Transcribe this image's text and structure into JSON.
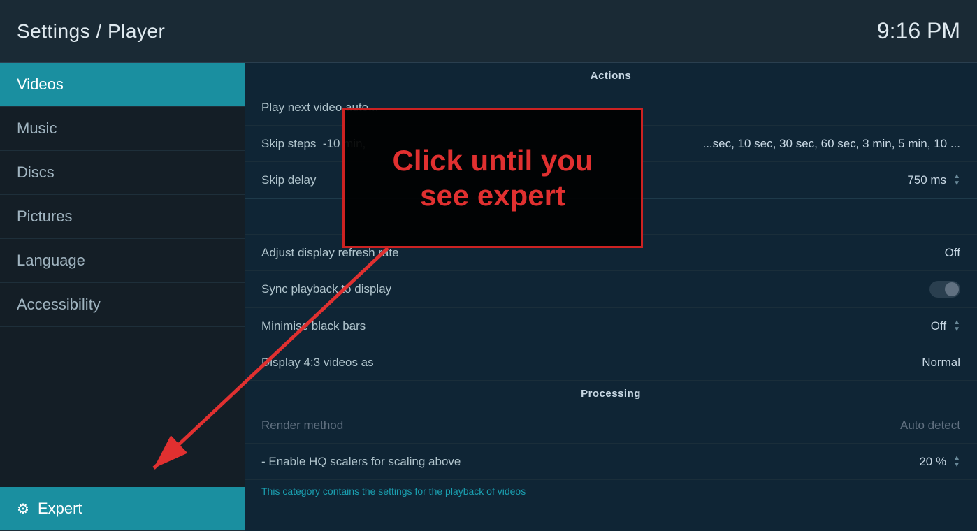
{
  "header": {
    "title": "Settings / Player",
    "time": "9:16 PM"
  },
  "sidebar": {
    "items": [
      {
        "id": "videos",
        "label": "Videos",
        "active": true
      },
      {
        "id": "music",
        "label": "Music",
        "active": false
      },
      {
        "id": "discs",
        "label": "Discs",
        "active": false
      },
      {
        "id": "pictures",
        "label": "Pictures",
        "active": false
      },
      {
        "id": "language",
        "label": "Language",
        "active": false
      },
      {
        "id": "accessibility",
        "label": "Accessibility",
        "active": false
      }
    ],
    "expert_label": "Expert"
  },
  "content": {
    "sections": [
      {
        "id": "actions",
        "header": "Actions",
        "rows": [
          {
            "id": "play-next-video",
            "label": "Play next video auto...",
            "value": "",
            "type": "text",
            "dimmed": false
          },
          {
            "id": "skip-steps",
            "label": "Skip steps   -10 min, ...",
            "value": "...sec, 10 sec, 30 sec, 60 sec, 3 min, 5 min, 10 ...",
            "type": "text",
            "dimmed": false
          },
          {
            "id": "skip-delay",
            "label": "Skip delay",
            "value": "750 ms",
            "type": "chevron",
            "dimmed": false
          }
        ]
      },
      {
        "id": "playback",
        "header": "",
        "rows": [
          {
            "id": "adjust-display-refresh",
            "label": "Adjust display refresh rate",
            "value": "Off",
            "type": "text",
            "dimmed": false
          },
          {
            "id": "sync-playback",
            "label": "Sync playback to display",
            "value": "",
            "type": "toggle",
            "dimmed": false
          },
          {
            "id": "minimise-black-bars",
            "label": "Minimise black bars",
            "value": "Off",
            "type": "chevron",
            "dimmed": false
          },
          {
            "id": "display-43",
            "label": "Display 4:3 videos as",
            "value": "Normal",
            "type": "text",
            "dimmed": false
          }
        ]
      },
      {
        "id": "processing",
        "header": "Processing",
        "rows": [
          {
            "id": "render-method",
            "label": "Render method",
            "value": "Auto detect",
            "type": "text",
            "dimmed": true
          },
          {
            "id": "enable-hq-scalers",
            "label": "- Enable HQ scalers for scaling above",
            "value": "20 %",
            "type": "chevron",
            "dimmed": false
          }
        ]
      }
    ],
    "status_hint": "This category contains the settings for the playback of videos"
  },
  "tooltip": {
    "text": "Click until you see expert"
  },
  "annotation": {
    "label": "Click until you\nsee expert"
  }
}
